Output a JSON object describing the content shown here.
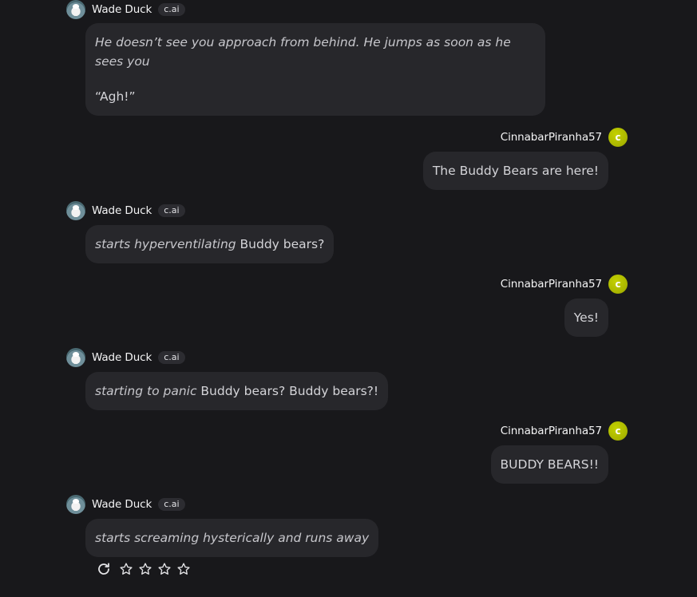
{
  "bot": {
    "name": "Wade Duck",
    "badge": "c.ai"
  },
  "user": {
    "name": "CinnabarPiranha57",
    "avatar_letter": "c",
    "avatar_color": "#a8b400"
  },
  "messages": [
    {
      "sender": "bot",
      "paragraphs": [
        {
          "italic": "He doesn’t see you approach from behind. He jumps as soon as he sees you",
          "plain": ""
        },
        {
          "italic": "",
          "plain": "“Agh!”"
        }
      ]
    },
    {
      "sender": "user",
      "text": "The Buddy Bears are here!"
    },
    {
      "sender": "bot",
      "italic": "starts hyperventilating",
      "plain": " Buddy bears?"
    },
    {
      "sender": "user",
      "text": "Yes!"
    },
    {
      "sender": "bot",
      "italic": "starting to panic",
      "plain": " Buddy bears? Buddy bears?!"
    },
    {
      "sender": "user",
      "text": "BUDDY BEARS!!"
    },
    {
      "sender": "bot",
      "italic": "starts screaming hysterically and runs away",
      "plain": ""
    }
  ],
  "actions": {
    "regenerate_icon": "refresh-icon",
    "rating_icon": "star-outline-icon",
    "rating_value": 0,
    "rating_max": 4
  },
  "colors": {
    "background": "#18181b",
    "bubble": "#27272b",
    "badge": "#2c2c31"
  }
}
